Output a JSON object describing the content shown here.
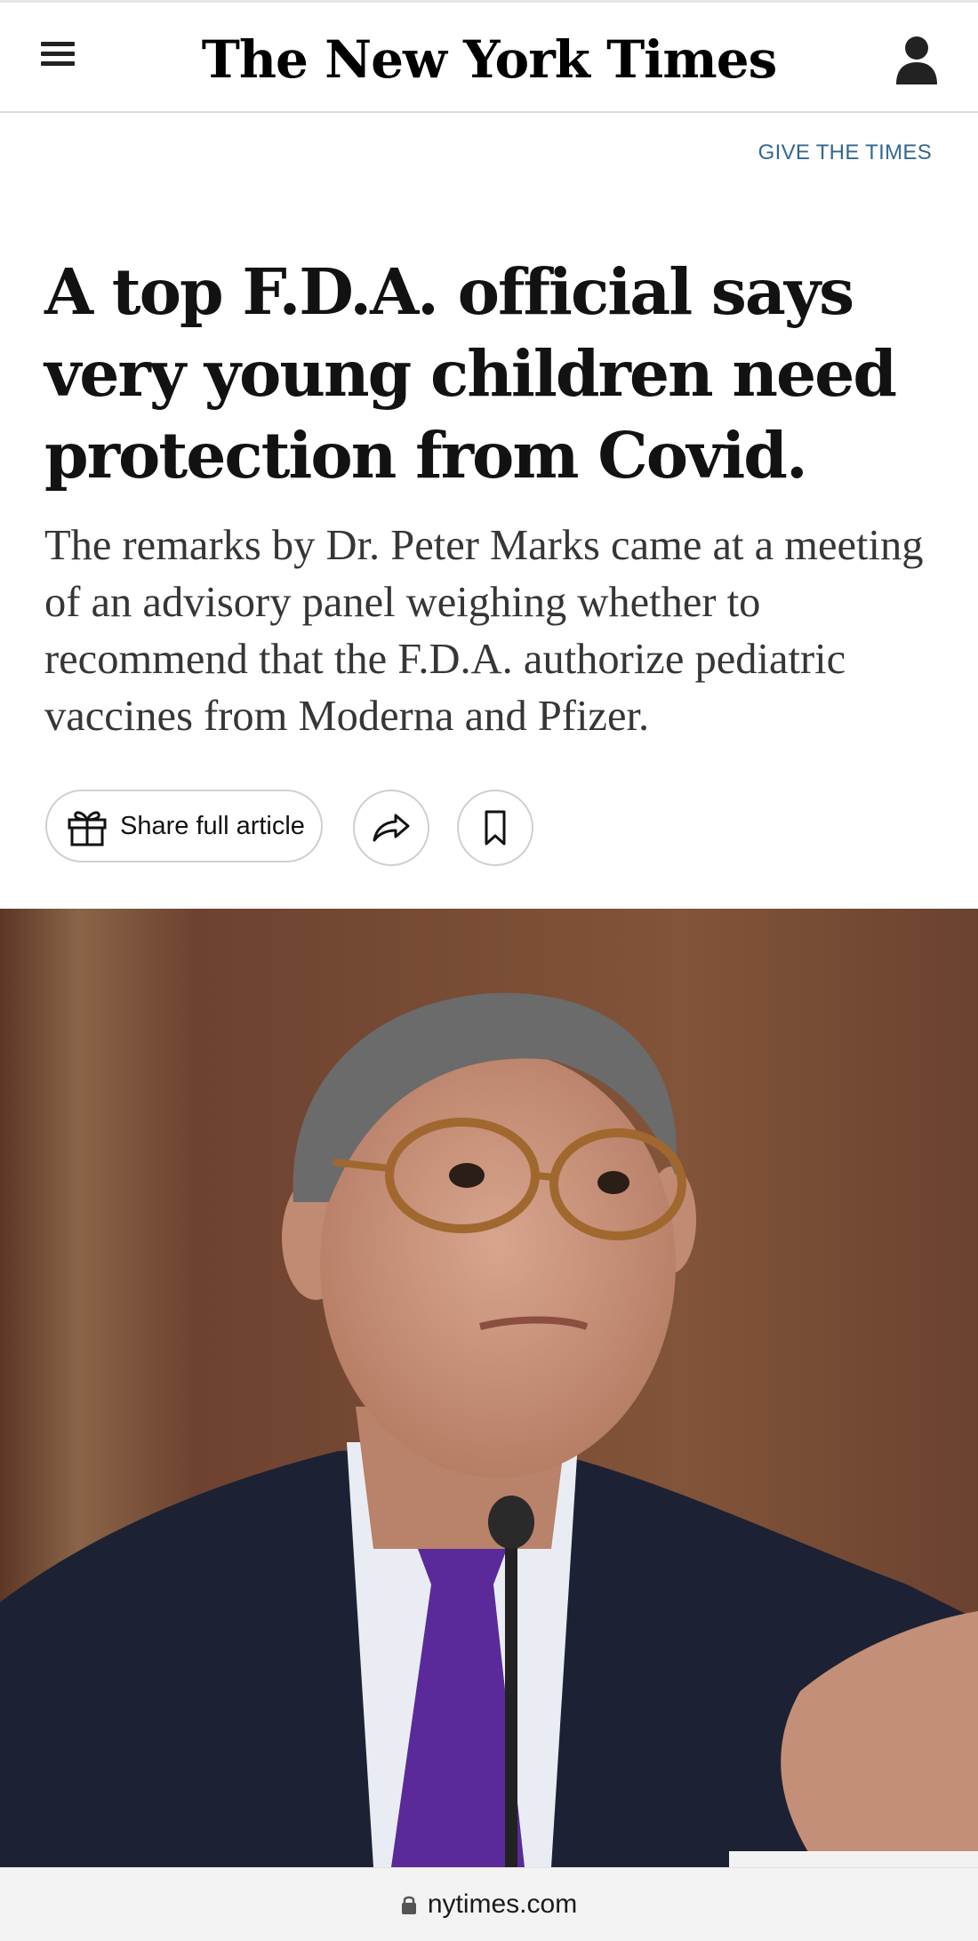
{
  "header": {
    "logo_text": "The New York Times",
    "menu_icon": "hamburger-menu-icon",
    "account_icon": "user-account-icon"
  },
  "promo": {
    "give_link": "GIVE THE TIMES"
  },
  "article": {
    "headline": "A top F.D.A. official says very young children need protection from Covid.",
    "summary": "The remarks by Dr. Peter Marks came at a meeting of an advisory panel weighing whether to recommend that the F.D.A. authorize pediatric vaccines from Moderna and Pfizer."
  },
  "actions": {
    "share_label": "Share full article",
    "gift_icon": "gift-icon",
    "share_icon": "share-arrow-icon",
    "save_icon": "bookmark-icon"
  },
  "browser": {
    "url": "nytimes.com",
    "lock_icon": "lock-icon"
  },
  "colors": {
    "link_blue": "#326891",
    "text": "#121212",
    "summary_text": "#363636"
  }
}
